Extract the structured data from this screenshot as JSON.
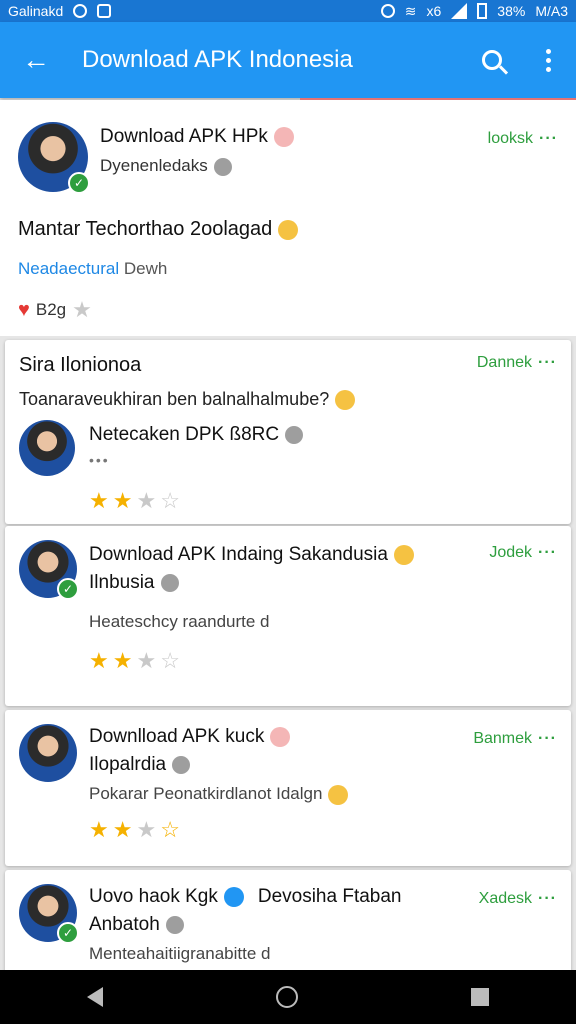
{
  "status": {
    "left_text": "Galinakd",
    "battery": "38%",
    "time": "M/A3",
    "signal_label": "x6"
  },
  "app_bar": {
    "title": "Download APK Indonesia"
  },
  "featured": {
    "name": "Download APK HPk",
    "handle": "Dyenenledaks",
    "action": "looksk",
    "tagline": "Mantar Techorthao 2oolagad",
    "link": "Neadaectural",
    "link_suffix": "Dewh",
    "rating": "B2g"
  },
  "cards": [
    {
      "title": "Sira Ilonionoa",
      "action": "Dannek",
      "text": "Toanaraveukhiran ben balnalhalmube?",
      "name": "Netecaken DPK ß8RC",
      "meta": "•••",
      "stars": [
        1,
        1,
        0,
        0
      ]
    },
    {
      "name": "Download APK Indaing Sakandusia",
      "handle": "Ilnbusia",
      "action": "Jodek",
      "desc": "Heateschcy raandurte d",
      "stars": [
        1,
        1,
        0,
        0
      ]
    },
    {
      "name": "Downlload APK kuck",
      "handle": "Ilopalrdia",
      "action": "Banmek",
      "desc": "Pokarar Peonatkirdlanot Idalgn",
      "stars": [
        1,
        1,
        0,
        2
      ]
    },
    {
      "name": "Uovo haok Kgk",
      "name_suffix": "Devosiha Ftaban",
      "handle": "Anbatoh",
      "action": "Xadesk",
      "desc": "Menteahaitiigranabitte d"
    }
  ]
}
